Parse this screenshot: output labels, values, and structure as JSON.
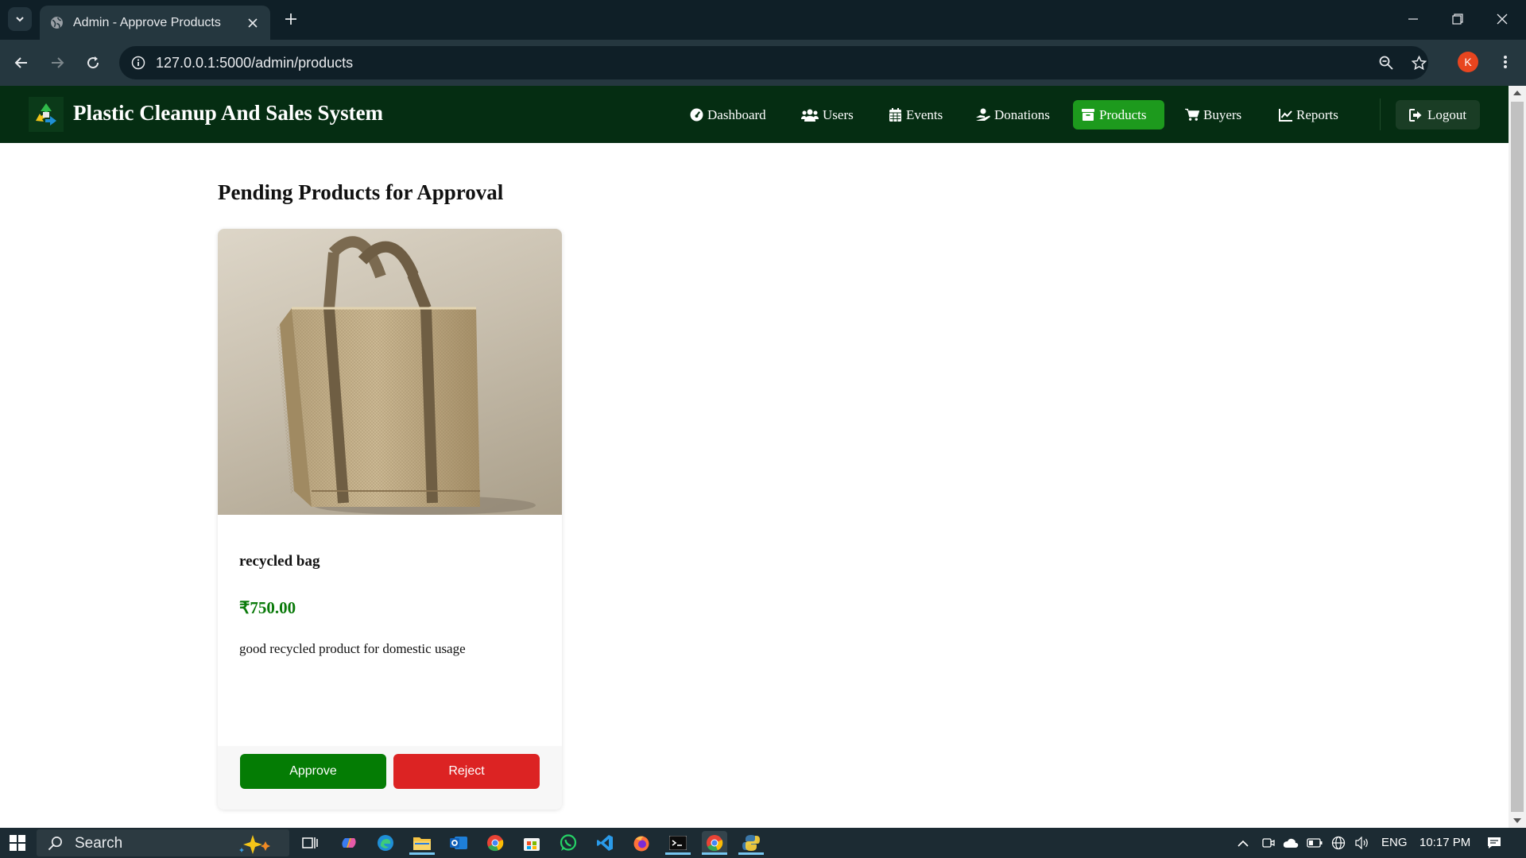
{
  "browser": {
    "tab_title": "Admin - Approve Products",
    "url": "127.0.0.1:5000/admin/products",
    "profile_initial": "K"
  },
  "app": {
    "brand": "Plastic Cleanup And Sales System",
    "nav": [
      {
        "label": "Dashboard",
        "icon": "tachometer-icon",
        "active": false
      },
      {
        "label": "Users",
        "icon": "users-icon",
        "active": false
      },
      {
        "label": "Events",
        "icon": "calendar-icon",
        "active": false
      },
      {
        "label": "Donations",
        "icon": "hand-holding-icon",
        "active": false
      },
      {
        "label": "Products",
        "icon": "box-icon",
        "active": true
      },
      {
        "label": "Buyers",
        "icon": "cart-icon",
        "active": false
      },
      {
        "label": "Reports",
        "icon": "chart-line-icon",
        "active": false
      }
    ],
    "logout_label": "Logout",
    "accent_color": "#1d9a1d",
    "navbar_color": "#052d12"
  },
  "page": {
    "heading": "Pending Products for Approval"
  },
  "product": {
    "name": "recycled bag",
    "price": "₹750.00",
    "description": "good recycled product for domestic usage",
    "approve_label": "Approve",
    "reject_label": "Reject",
    "approve_color": "#047c04",
    "reject_color": "#dc2323"
  },
  "taskbar": {
    "search_placeholder": "Search",
    "language": "ENG",
    "time": "10:17 PM"
  }
}
